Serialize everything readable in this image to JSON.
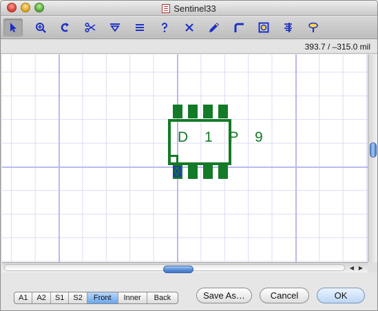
{
  "window": {
    "title": "Sentinel33"
  },
  "toolbar": {
    "tools": [
      {
        "name": "select-arrow-icon",
        "glyph": "↖"
      },
      {
        "name": "zoom-icon",
        "glyph": "⊕"
      },
      {
        "name": "rotate-icon",
        "glyph": "↺"
      },
      {
        "name": "scissors-icon",
        "glyph": "✂"
      },
      {
        "name": "flip-vertical-icon",
        "glyph": "▽"
      },
      {
        "name": "equals-icon",
        "glyph": "≡"
      },
      {
        "name": "help-icon",
        "glyph": "?"
      },
      {
        "name": "delete-icon",
        "glyph": "✕"
      },
      {
        "name": "pencil-icon",
        "glyph": "✎"
      },
      {
        "name": "corner-icon",
        "glyph": "⌜"
      },
      {
        "name": "target-icon",
        "glyph": "◎"
      },
      {
        "name": "align-icon",
        "glyph": "⫸"
      },
      {
        "name": "pin-icon",
        "glyph": "♀"
      }
    ]
  },
  "status": {
    "coordinates": "393.7 / –315.0 mil"
  },
  "component": {
    "label": "D 1 P 9",
    "color": "#137a28"
  },
  "layers": {
    "items": [
      "A1",
      "A2",
      "S1",
      "S2",
      "Front",
      "Inner",
      "Back"
    ],
    "selected": "Front"
  },
  "buttons": {
    "save_as": "Save As…",
    "cancel": "Cancel",
    "ok": "OK"
  },
  "colors": {
    "grid_major": "#b9b9ee",
    "grid_minor": "#dcdcf4",
    "accent": "#5a8fd8"
  }
}
